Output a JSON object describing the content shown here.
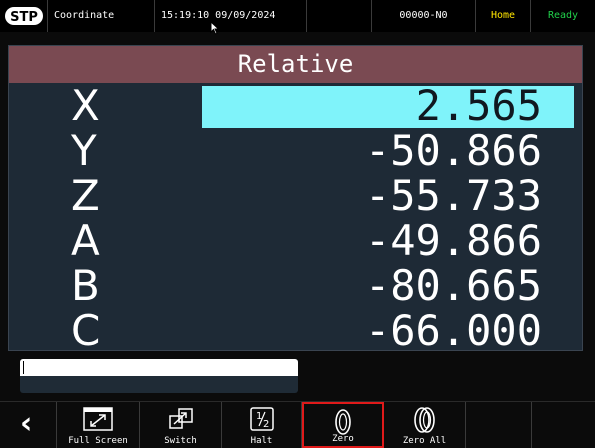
{
  "status_bar": {
    "title": "Coordinate",
    "datetime": "15:19:10 09/09/2024",
    "program": "00000-N0",
    "mode": "Home",
    "state": "Ready"
  },
  "panel": {
    "title": "Relative",
    "axes": [
      {
        "label": "X",
        "value": "2.565",
        "selected": true
      },
      {
        "label": "Y",
        "value": "-50.866",
        "selected": false
      },
      {
        "label": "Z",
        "value": "-55.733",
        "selected": false
      },
      {
        "label": "A",
        "value": "-49.866",
        "selected": false
      },
      {
        "label": "B",
        "value": "-80.665",
        "selected": false
      },
      {
        "label": "C",
        "value": "-66.000",
        "selected": false
      }
    ]
  },
  "input": {
    "value": ""
  },
  "toolbar": {
    "full_screen": "Full Screen",
    "switch": "Switch",
    "halt": "Halt",
    "zero": "Zero",
    "zero_all": "Zero All"
  },
  "colors": {
    "header": "#7a4a52",
    "panel_bg": "#1e2a36",
    "selected_bg": "#7ff3fa",
    "home": "#ffe600",
    "ready": "#21d04a",
    "highlight_border": "#e01a1a"
  },
  "icons": [
    "logo-icon",
    "cursor-icon",
    "back-chevron-icon",
    "full-screen-icon",
    "switch-icon",
    "halt-icon",
    "zero-icon",
    "zero-all-icon"
  ]
}
